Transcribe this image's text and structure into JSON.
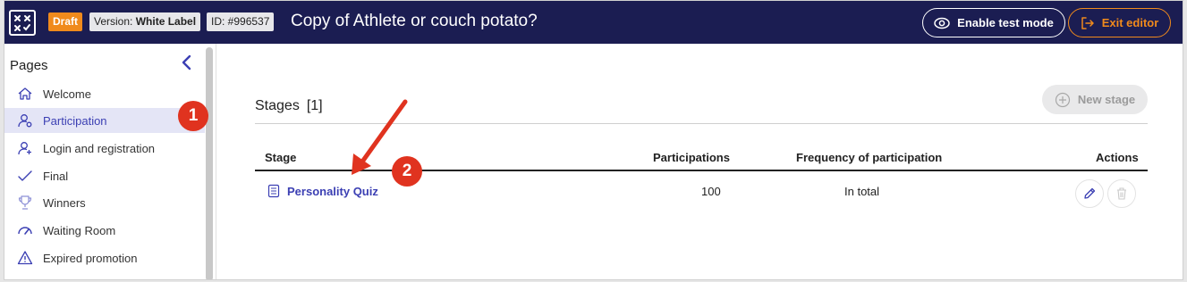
{
  "header": {
    "status_badge": "Draft",
    "version_label": "Version:",
    "version_value": "White Label",
    "id_badge": "ID: #996537",
    "title": "Copy of Athlete or couch potato?",
    "test_mode_label": "Enable test mode",
    "exit_label": "Exit editor"
  },
  "sidebar": {
    "title": "Pages",
    "items": [
      {
        "label": "Welcome",
        "icon": "home-icon"
      },
      {
        "label": "Participation",
        "icon": "user-gear-icon",
        "active": true
      },
      {
        "label": "Login and registration",
        "icon": "user-add-icon"
      },
      {
        "label": "Final",
        "icon": "checkmark-icon"
      },
      {
        "label": "Winners",
        "icon": "trophy-icon"
      },
      {
        "label": "Waiting Room",
        "icon": "speedometer-icon"
      },
      {
        "label": "Expired promotion",
        "icon": "warning-icon"
      }
    ]
  },
  "main": {
    "stages_title": "Stages",
    "stages_count": "[1]",
    "new_stage_label": "New stage",
    "columns": [
      "Stage",
      "Participations",
      "Frequency of participation",
      "Actions"
    ],
    "rows": [
      {
        "stage": "Personality Quiz",
        "participations": "100",
        "frequency": "In total"
      }
    ]
  },
  "annotations": [
    {
      "number": "1"
    },
    {
      "number": "2"
    }
  ],
  "colors": {
    "header_bg": "#1b1d52",
    "accent_orange": "#f08a1c",
    "link_blue": "#3b3fb3",
    "active_bg": "#e4e5f6",
    "annotation_red": "#e0331f"
  }
}
